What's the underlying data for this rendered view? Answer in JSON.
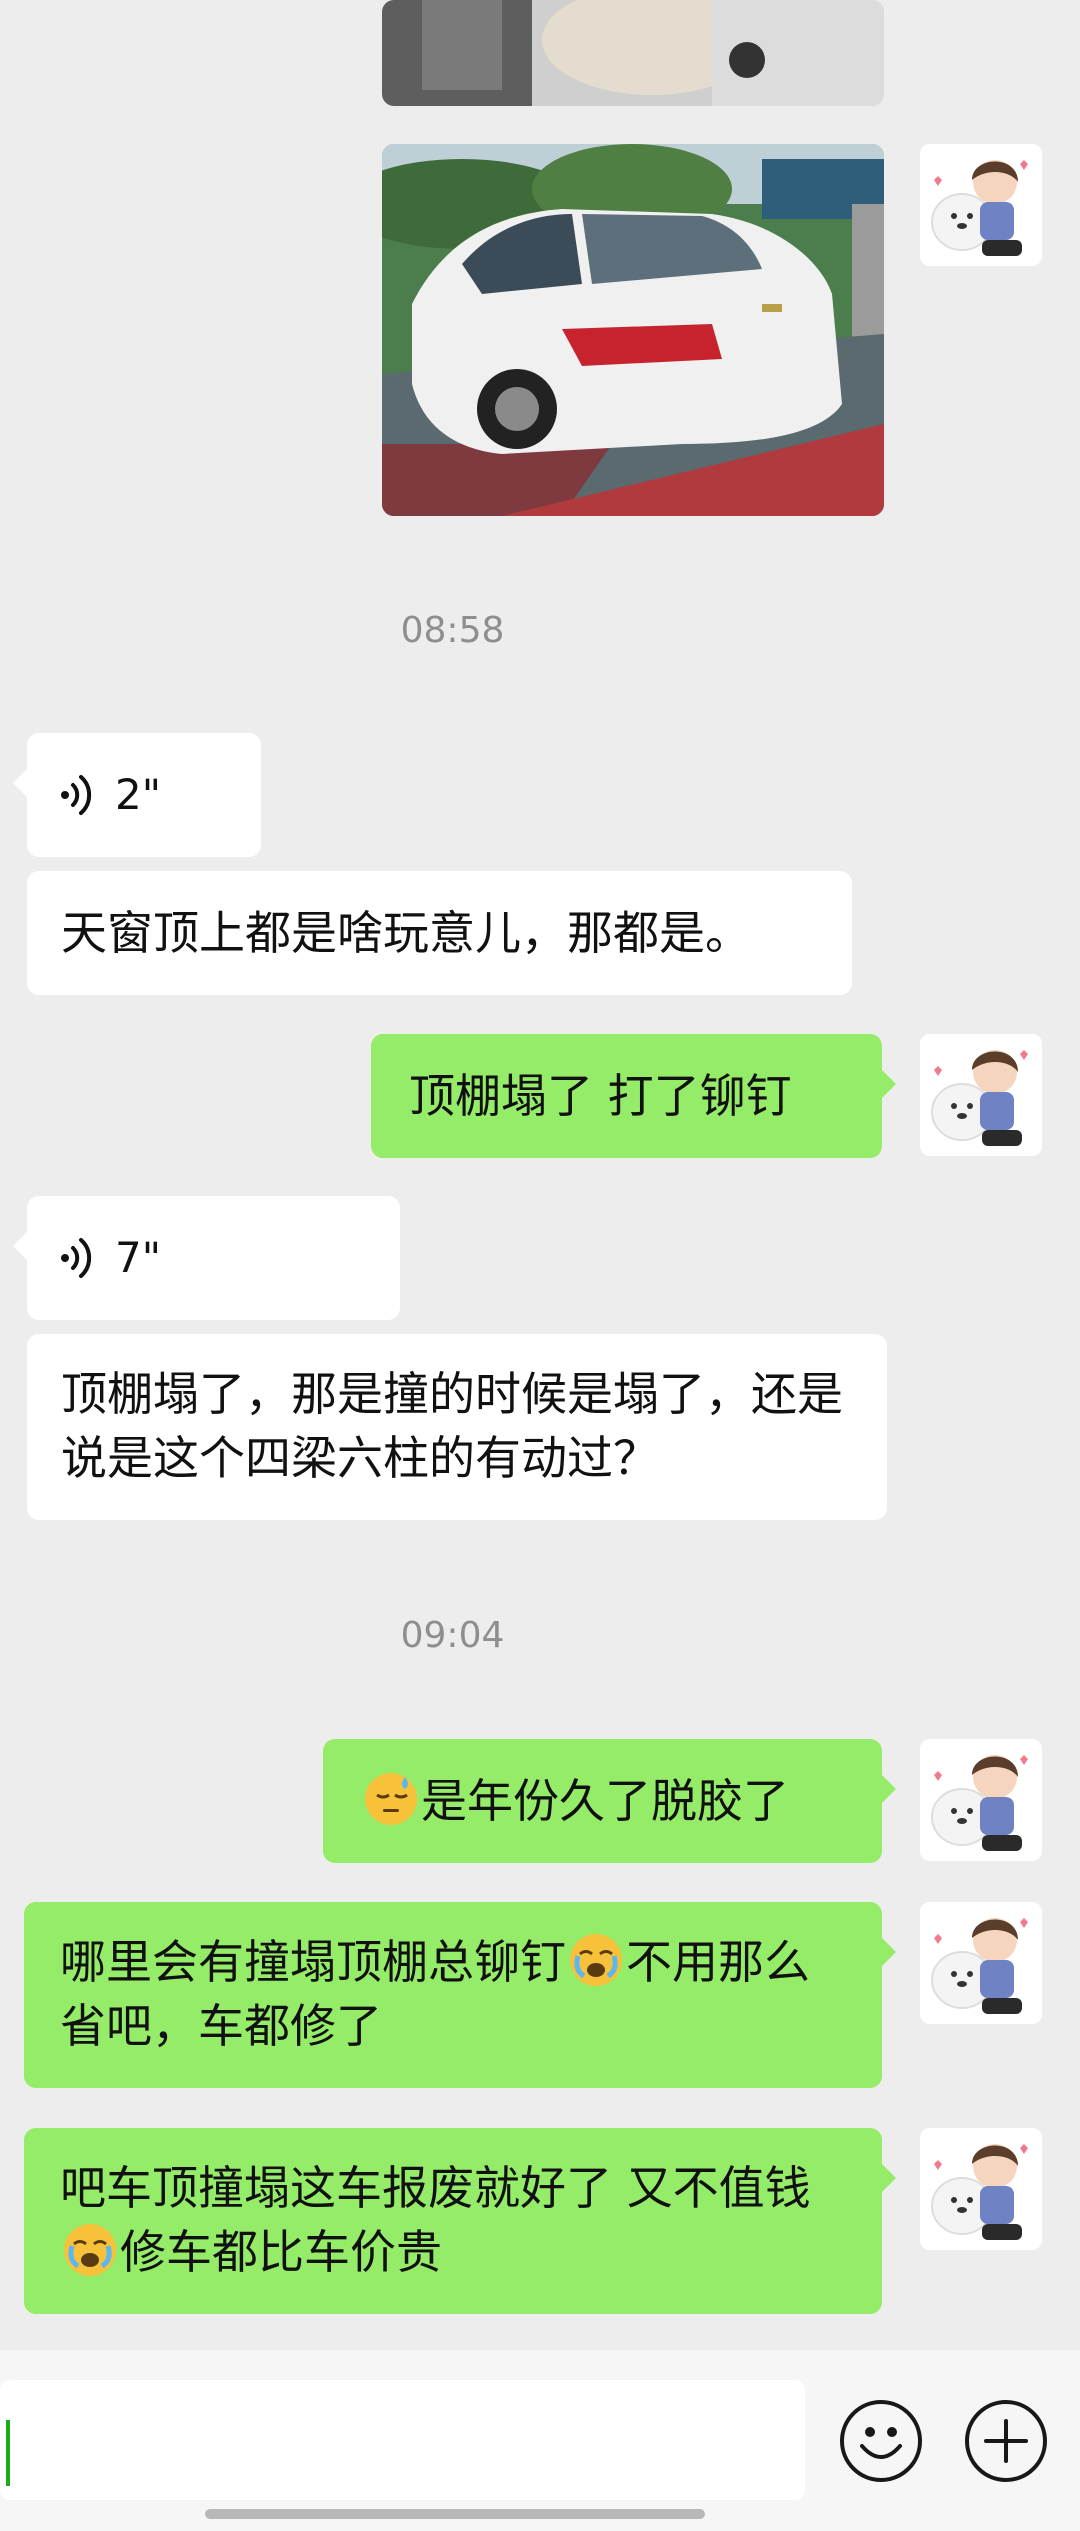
{
  "messages": {
    "ts1": "08:58",
    "voice1": "2\"",
    "text1": "天窗顶上都是啥玩意儿，那都是。",
    "reply1": "顶棚塌了 打了铆钉",
    "voice2": "7\"",
    "text2": "顶棚塌了，那是撞的时候是塌了，还是说是这个四梁六柱的有动过？",
    "ts2": "09:04",
    "reply2_text": "是年份久了脱胶了",
    "reply3_a": "哪里会有撞塌顶棚总铆钉",
    "reply3_b": "不用那么省吧，车都修了",
    "reply4_a": "吧车顶撞塌这车报废就好了 又不值钱",
    "reply4_b": "修车都比车价贵"
  },
  "icons": {
    "voice": "voice-message-icon",
    "emoji": "emoji-button-icon",
    "plus": "plus-button-icon"
  },
  "colors": {
    "background": "#ededed",
    "sent_bubble": "#95ec69",
    "received_bubble": "#ffffff"
  }
}
